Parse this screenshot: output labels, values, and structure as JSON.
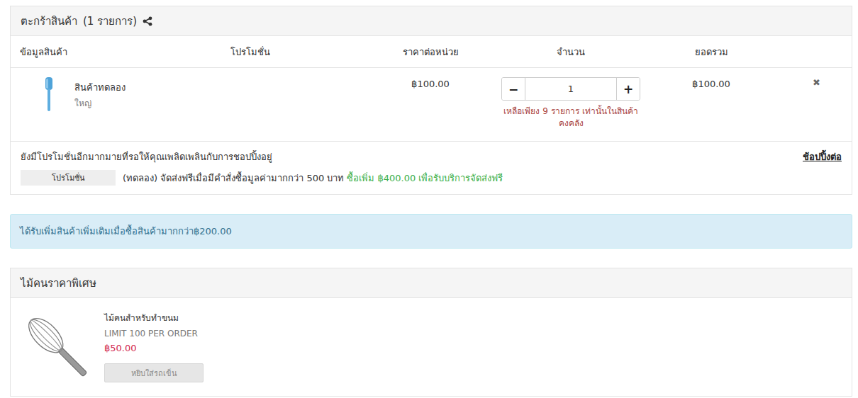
{
  "cart": {
    "title": "ตะกร้าสินค้า",
    "count": "(1 รายการ)",
    "columns": [
      "ข้อมูลสินค้า",
      "โปรโมชั่น",
      "ราคาต่อหน่วย",
      "จำนวน",
      "ยอดรวม"
    ],
    "items": [
      {
        "name": "สินค้าทดลอง",
        "variant": "ใหญ่",
        "price": "฿100.00",
        "quantity": "1",
        "minus": "−",
        "plus": "+",
        "stock_note": "เหลือเพียง 9 รายการ เท่านั้นในสินค้าคงคลัง",
        "total": "฿100.00",
        "remove": "✖"
      }
    ]
  },
  "promotions": {
    "note": "ยังมีโปรโมชั่นอีกมากมายที่รอให้คุณเพลิดเพลินกับการชอปปิ้งอยู่",
    "continue_link": "ช้อปปิ้งต่อ",
    "items": [
      {
        "badge": "โปรโมชั่น",
        "text": "(ทดลอง) จัดส่งฟรีเมื่อมีคำสั่งซื้อมูลค่ามากกว่า 500 บาท",
        "upsell": "ซื้อเพิ่ม ฿400.00 เพื่อรับบริการจัดส่งฟรี"
      }
    ]
  },
  "alert": "ได้รับเพิ่มสินค้าเพิ่มเติมเมื่อซื้อสินค้ามากกว่า฿200.00",
  "special": {
    "title": "ไม้คนราคาพิเศษ",
    "products": [
      {
        "name": "ไม้คนสำหรับทำขนม",
        "limit": "LIMIT 100 PER ORDER",
        "price": "฿50.00",
        "button": "หยิบใส่รถเข็น",
        "disabled": true
      }
    ]
  }
}
